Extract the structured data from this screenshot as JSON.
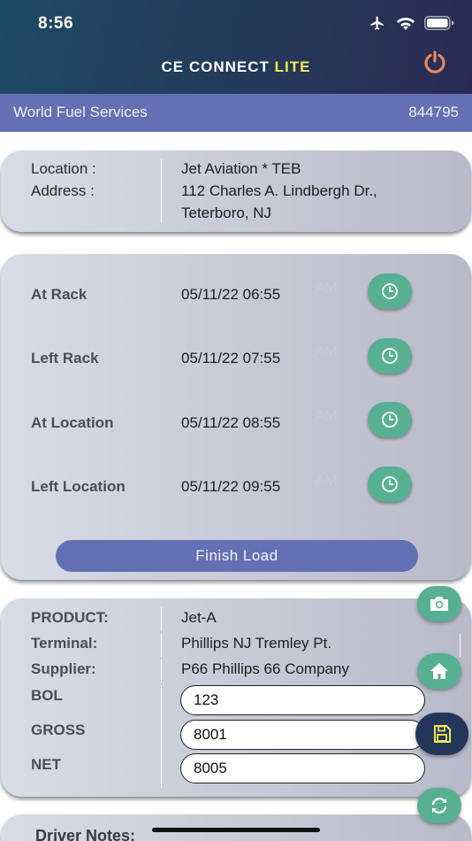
{
  "status_bar": {
    "time": "8:56"
  },
  "header": {
    "title_main": "CE CONNECT",
    "title_accent": "LITE"
  },
  "subbar": {
    "company": "World Fuel Services",
    "number": "844795"
  },
  "location_card": {
    "location_label": "Location :",
    "address_label": "Address :",
    "location_value": "Jet Aviation * TEB",
    "address_line1": "112 Charles A. Lindbergh Dr.,",
    "address_line2": "Teterboro, NJ"
  },
  "times_card": {
    "rows": [
      {
        "label": "At Rack",
        "value": "05/11/22 06:55",
        "ghost": "AM"
      },
      {
        "label": "Left Rack",
        "value": "05/11/22 07:55",
        "ghost": "AM"
      },
      {
        "label": "At Location",
        "value": "05/11/22 08:55",
        "ghost": "AM"
      },
      {
        "label": "Left Location",
        "value": "05/11/22 09:55",
        "ghost": "AM"
      }
    ],
    "finish_label": "Finish Load"
  },
  "product_card": {
    "product_label": "PRODUCT:",
    "product_value": "Jet-A",
    "terminal_label": "Terminal:",
    "terminal_value": "Phillips NJ Tremley Pt.",
    "supplier_label": "Supplier:",
    "supplier_value": "P66 Phillips 66 Company",
    "bol_label": "BOL",
    "bol_value": "123",
    "gross_label": "GROSS",
    "gross_value": "8001",
    "net_label": "NET",
    "net_value": "8005"
  },
  "notes": {
    "label": "Driver Notes:"
  },
  "colors": {
    "header_dark": "#24395a",
    "accent_blue": "#6470b4",
    "green": "#58b093",
    "lite_yellow": "#f1ea53",
    "power_orange": "#e8875f"
  },
  "icons": [
    "airplane-icon",
    "wifi-icon",
    "battery-icon",
    "power-icon",
    "clock-icon",
    "camera-icon",
    "home-icon",
    "save-icon",
    "refresh-icon"
  ]
}
